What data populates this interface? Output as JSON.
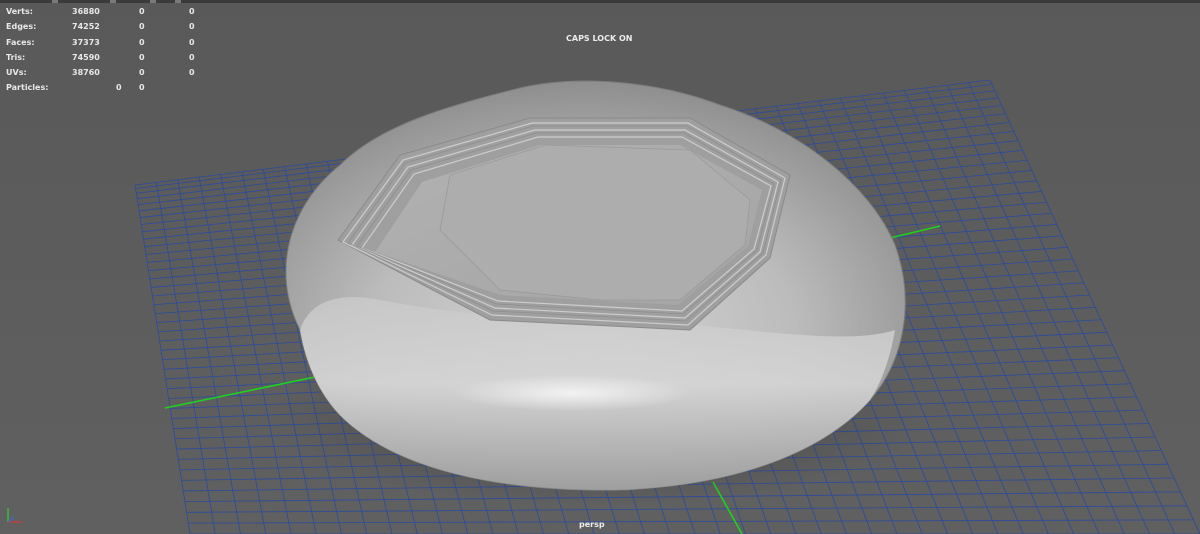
{
  "hud": {
    "rows": [
      {
        "label": "Verts:",
        "v1": "36880",
        "v2": "0",
        "v3": "0"
      },
      {
        "label": "Edges:",
        "v1": "74252",
        "v2": "0",
        "v3": "0"
      },
      {
        "label": "Faces:",
        "v1": "37373",
        "v2": "0",
        "v3": "0"
      },
      {
        "label": "Tris:",
        "v1": "74590",
        "v2": "0",
        "v3": "0"
      },
      {
        "label": "UVs:",
        "v1": "38760",
        "v2": "0",
        "v3": "0"
      }
    ],
    "particles": {
      "label": "Particles:",
      "v1": "0",
      "v2": "0"
    }
  },
  "status": {
    "caps_lock": "CAPS LOCK ON"
  },
  "camera": {
    "name": "persp"
  },
  "colors": {
    "viewport_bg": "#5d5d5d",
    "grid_line": "#2b4b9e",
    "grid_axis": "#1fd11f",
    "model": "#bcbcbc",
    "hud_text": "#e8e8e8"
  },
  "icons": {
    "axis_gizmo": "view-axis-icon"
  }
}
